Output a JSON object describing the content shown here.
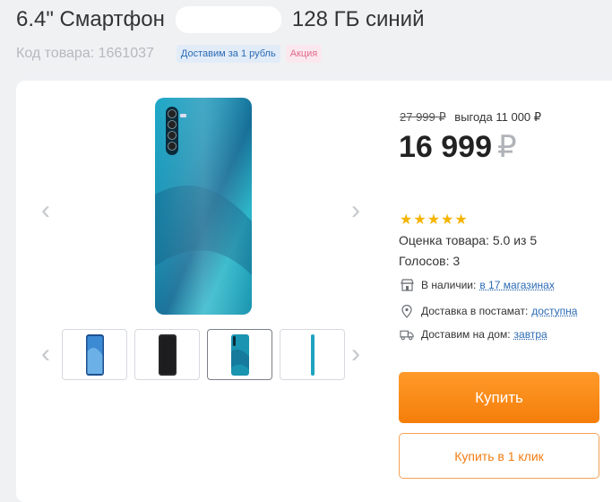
{
  "product": {
    "title_prefix": "6.4\" Смартфон",
    "title_suffix": "128 ГБ синий",
    "sku": "Код товара: 1661037",
    "badges": [
      "Доставим за 1 рубль",
      "Акция"
    ]
  },
  "pricing": {
    "old_price": "27 999 ₽",
    "saving": "выгода 11 000 ₽",
    "price": "16 999",
    "currency": "₽"
  },
  "rating": {
    "stars": 5,
    "score_text": "Оценка товара: 5.0 из 5",
    "votes_text": "Голосов: 3"
  },
  "availability": {
    "in_stock_label": "В наличии:",
    "in_stock_link": "в 17 магазинах",
    "postamat_label": "Доставка в постамат:",
    "postamat_link": "доступна",
    "home_label": "Доставим на дом:",
    "home_link": "завтра"
  },
  "actions": {
    "buy": "Купить",
    "one_click": "Купить в 1 клик"
  },
  "gallery": {
    "thumbnails": [
      "phone-front",
      "phone-dark",
      "phone-back-blue",
      "phone-side"
    ],
    "active_index": 2
  }
}
